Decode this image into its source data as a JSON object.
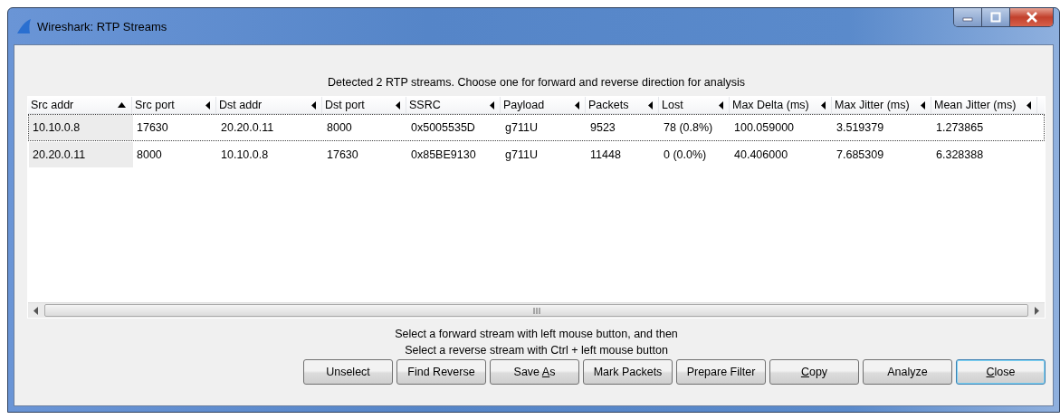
{
  "window": {
    "title": "Wireshark: RTP Streams"
  },
  "message": "Detected 2 RTP streams. Choose one for forward and reverse direction for analysis",
  "table": {
    "columns": [
      {
        "label": "Src addr",
        "sorted": true
      },
      {
        "label": "Src port",
        "sorted": false
      },
      {
        "label": "Dst addr",
        "sorted": false
      },
      {
        "label": "Dst port",
        "sorted": false
      },
      {
        "label": "SSRC",
        "sorted": false
      },
      {
        "label": "Payload",
        "sorted": false
      },
      {
        "label": "Packets",
        "sorted": false
      },
      {
        "label": "Lost",
        "sorted": false
      },
      {
        "label": "Max Delta (ms)",
        "sorted": false
      },
      {
        "label": "Max Jitter (ms)",
        "sorted": false
      },
      {
        "label": "Mean Jitter (ms)",
        "sorted": false
      }
    ],
    "rows": [
      {
        "focused": true,
        "cells": [
          "10.10.0.8",
          "17630",
          "20.20.0.11",
          "8000",
          "0x5005535D",
          "g711U",
          "9523",
          "78 (0.8%)",
          "100.059000",
          "3.519379",
          "1.273865"
        ]
      },
      {
        "focused": false,
        "cells": [
          "20.20.0.11",
          "8000",
          "10.10.0.8",
          "17630",
          "0x85BE9130",
          "g711U",
          "11448",
          "0 (0.0%)",
          "40.406000",
          "7.685309",
          "6.328388"
        ]
      }
    ]
  },
  "hints": [
    "Select a forward stream with left mouse button, and then",
    "Select a reverse stream with Ctrl + left mouse button"
  ],
  "buttons": [
    {
      "pre": "Unselect",
      "default": false
    },
    {
      "pre": "Find Reverse",
      "default": false
    },
    {
      "pre": "Save ",
      "key": "A",
      "post": "s",
      "default": false
    },
    {
      "pre": "Mark Packets",
      "default": false
    },
    {
      "pre": "Prepare Filter",
      "default": false
    },
    {
      "key": "C",
      "post": "opy",
      "default": false
    },
    {
      "pre": "Analyze",
      "default": false
    },
    {
      "key": "C",
      "post": "lose",
      "default": true
    }
  ]
}
